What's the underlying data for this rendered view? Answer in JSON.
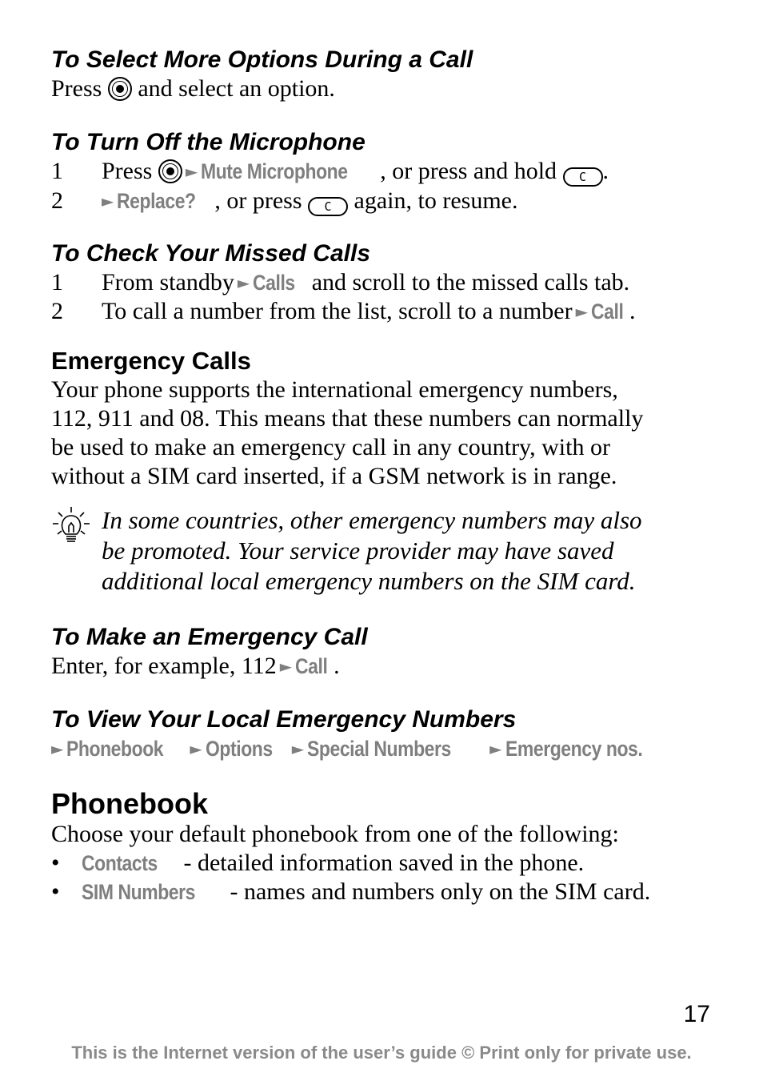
{
  "sections": {
    "more_options": {
      "heading": "To Select More Options During a Call",
      "text_before": "Press",
      "text_after": "and select an option."
    },
    "microphone": {
      "heading": "To Turn Off the Microphone",
      "step1_num": "1",
      "step1_press": "Press",
      "step1_menu": "Mute Microphone",
      "step1_after": ", or press and hold",
      "step1_end": ".",
      "step2_num": "2",
      "step2_menu": "Replace?",
      "step2_after": ", or press",
      "step2_end": "again, to resume."
    },
    "missed_calls": {
      "heading": "To Check Your Missed Calls",
      "step1_num": "1",
      "step1_before": "From standby",
      "step1_menu": "Calls",
      "step1_after": "and scroll to the missed calls tab.",
      "step2_num": "2",
      "step2_before": "To call a number from the list, scroll to a number",
      "step2_menu": "Call",
      "step2_end": "."
    },
    "emergency": {
      "heading": "Emergency Calls",
      "body": [
        "Your phone supports the international emergency numbers,",
        "112, 911 and 08. This means that these numbers can normally",
        "be used to make an emergency call in any country, with or",
        "without a SIM card inserted, if a GSM network is in range."
      ],
      "tip": [
        "In some countries, other emergency numbers may also",
        "be promoted. Your service provider may have saved",
        "additional local emergency numbers on the SIM card."
      ]
    },
    "make_emergency": {
      "heading": "To Make an Emergency Call",
      "before": "Enter, for example, 112",
      "menu": "Call",
      "end": "."
    },
    "view_local": {
      "heading": "To View Your Local Emergency Numbers",
      "path": [
        "Phonebook",
        "Options",
        "Special Numbers",
        "Emergency nos."
      ]
    },
    "phonebook": {
      "heading": "Phonebook",
      "intro": "Choose your default phonebook from one of the following:",
      "items": [
        {
          "bullet": "•",
          "label": "Contacts",
          "desc": "- detailed information saved in the phone."
        },
        {
          "bullet": "•",
          "label": "SIM Numbers",
          "desc": "- names and numbers only on the SIM card."
        }
      ]
    }
  },
  "keys": {
    "c_key": "C",
    "arrow": "►"
  },
  "page_number": "17",
  "footer": "This is the Internet version of the user’s guide © Print only for private use."
}
